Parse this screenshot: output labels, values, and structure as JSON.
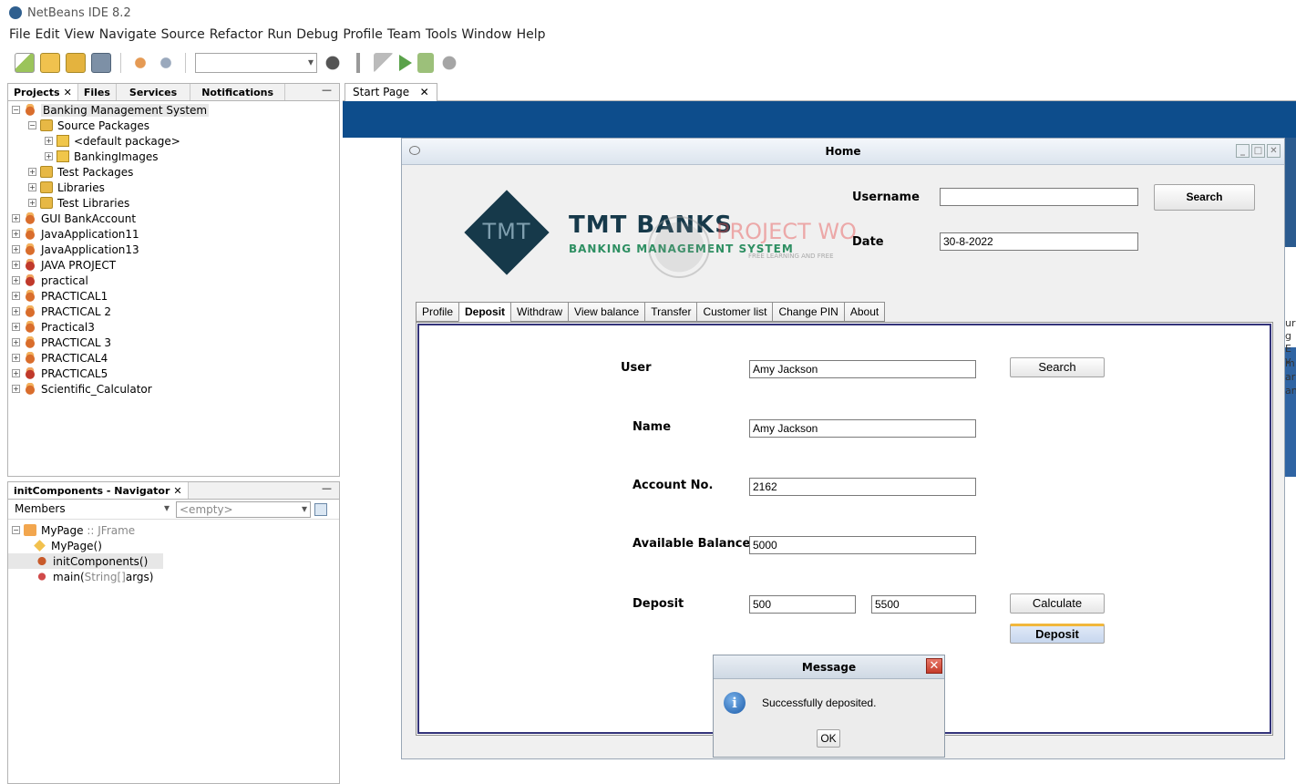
{
  "app": {
    "title": "NetBeans IDE 8.2"
  },
  "menu": [
    "File",
    "Edit",
    "View",
    "Navigate",
    "Source",
    "Refactor",
    "Run",
    "Debug",
    "Profile",
    "Team",
    "Tools",
    "Window",
    "Help"
  ],
  "projects_panel": {
    "tabs": [
      "Projects",
      "Files",
      "Services",
      "Notifications"
    ],
    "tree": [
      {
        "label": "Banking Management System",
        "level": 0,
        "icon": "project-icon",
        "selected": true
      },
      {
        "label": "Source Packages",
        "level": 1,
        "icon": "folder-icon"
      },
      {
        "label": "<default package>",
        "level": 2,
        "icon": "package-icon"
      },
      {
        "label": "BankingImages",
        "level": 2,
        "icon": "package-icon"
      },
      {
        "label": "Test Packages",
        "level": 1,
        "icon": "folder-icon"
      },
      {
        "label": "Libraries",
        "level": 1,
        "icon": "folder-icon"
      },
      {
        "label": "Test Libraries",
        "level": 1,
        "icon": "folder-icon"
      },
      {
        "label": "GUI BankAccount",
        "level": 0,
        "icon": "project-icon"
      },
      {
        "label": "JavaApplication11",
        "level": 0,
        "icon": "project-icon"
      },
      {
        "label": "JavaApplication13",
        "level": 0,
        "icon": "project-icon"
      },
      {
        "label": "JAVA PROJECT",
        "level": 0,
        "icon": "project-error-icon"
      },
      {
        "label": "practical",
        "level": 0,
        "icon": "project-error-icon"
      },
      {
        "label": "PRACTICAL1",
        "level": 0,
        "icon": "project-icon"
      },
      {
        "label": "PRACTICAL 2",
        "level": 0,
        "icon": "project-icon"
      },
      {
        "label": "Practical3",
        "level": 0,
        "icon": "project-icon"
      },
      {
        "label": "PRACTICAL 3",
        "level": 0,
        "icon": "project-icon"
      },
      {
        "label": "PRACTICAL4",
        "level": 0,
        "icon": "project-icon"
      },
      {
        "label": "PRACTICAL5",
        "level": 0,
        "icon": "project-error-icon"
      },
      {
        "label": "Scientific_Calculator",
        "level": 0,
        "icon": "project-icon"
      }
    ]
  },
  "navigator": {
    "title": "initComponents - Navigator",
    "filter": "Members",
    "combo": "<empty>",
    "root": "MyPage",
    "root_type": ":: JFrame",
    "members": [
      "MyPage()",
      "initComponents()"
    ],
    "main_method": "main(",
    "main_param": "String[]",
    "main_tail": " args)"
  },
  "editor": {
    "tab": "Start Page"
  },
  "home": {
    "title": "Home",
    "logo": {
      "mark": "TMT",
      "name": "TMT BANKS",
      "subtitle": "BANKING MANAGEMENT SYSTEM"
    },
    "watermark": {
      "text": "PROJECT WO",
      "sub": "FREE LEARNING AND FREE"
    },
    "username_label": "Username",
    "username_value": "",
    "search_label": "Search",
    "date_label": "Date",
    "date_value": "30-8-2022",
    "tabs": [
      "Profile",
      "Deposit",
      "Withdraw",
      "View balance",
      "Transfer",
      "Customer list",
      "Change PIN",
      "About"
    ],
    "active_tab": "Deposit",
    "deposit": {
      "user_label": "User",
      "user_value": "Amy Jackson",
      "search_button": "Search",
      "name_label": "Name",
      "name_value": "Amy Jackson",
      "account_label": "Account No.",
      "account_value": "2162",
      "balance_label": "Available Balance",
      "balance_value": "5000",
      "deposit_label": "Deposit",
      "deposit_amount": "500",
      "new_balance": "5500",
      "calculate_button": "Calculate",
      "deposit_button": "Deposit"
    }
  },
  "message_dialog": {
    "title": "Message",
    "text": "Successfully deposited.",
    "ok": "OK"
  },
  "colors": {
    "accent_blue": "#0d4d8c",
    "logo_dark": "#16394a",
    "logo_green": "#2e8f62",
    "tab_border": "#33337a"
  }
}
